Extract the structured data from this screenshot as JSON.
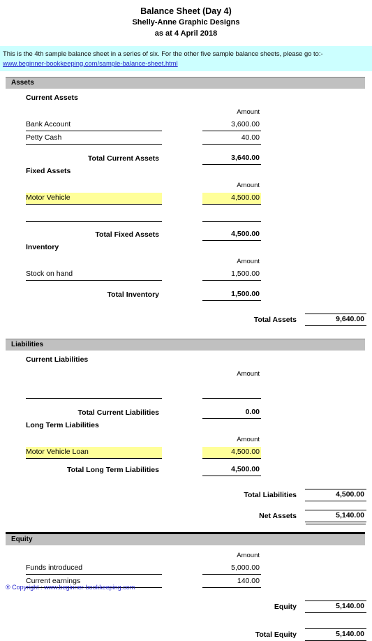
{
  "header": {
    "title": "Balance Sheet (Day 4)",
    "company": "Shelly-Anne Graphic Designs",
    "as_at": "as at 4 April 2018"
  },
  "banner": {
    "text": "This is the 4th sample balance sheet in a series of six. For the other five sample balance sheets, please go to:-",
    "link": "www.beginner-bookkeeping.com/sample-balance-sheet.html"
  },
  "amount_header": "Amount",
  "sections": {
    "assets": {
      "bar_label": "Assets",
      "current": {
        "subhead": "Current Assets",
        "rows": [
          {
            "label": "Bank Account",
            "amount": "3,600.00"
          },
          {
            "label": "Petty Cash",
            "amount": "40.00"
          }
        ],
        "total_label": "Total Current Assets",
        "total_amount": "3,640.00"
      },
      "fixed": {
        "subhead": "Fixed Assets",
        "rows": [
          {
            "label": "Motor Vehicle",
            "amount": "4,500.00"
          },
          {
            "label": "",
            "amount": ""
          }
        ],
        "total_label": "Total Fixed Assets",
        "total_amount": "4,500.00"
      },
      "inventory": {
        "subhead": "Inventory",
        "rows": [
          {
            "label": "Stock on hand",
            "amount": "1,500.00"
          }
        ],
        "total_label": "Total Inventory",
        "total_amount": "1,500.00"
      },
      "grand_label": "Total Assets",
      "grand_amount": "9,640.00"
    },
    "liabilities": {
      "bar_label": "Liabilities",
      "current": {
        "subhead": "Current Liabilities",
        "rows": [
          {
            "label": "",
            "amount": ""
          }
        ],
        "total_label": "Total Current Liabilities",
        "total_amount": "0.00"
      },
      "long_term": {
        "subhead": "Long Term Liabilities",
        "rows": [
          {
            "label": "Motor Vehicle Loan",
            "amount": "4,500.00"
          }
        ],
        "total_label": "Total Long Term Liabilities",
        "total_amount": "4,500.00"
      },
      "grand_label": "Total Liabilities",
      "grand_amount": "4,500.00",
      "net_assets_label": "Net Assets",
      "net_assets_amount": "5,140.00"
    },
    "equity": {
      "bar_label": "Equity",
      "rows": [
        {
          "label": "Funds introduced",
          "amount": "5,000.00"
        },
        {
          "label": "Current earnings",
          "amount": "140.00"
        }
      ],
      "grand_label": "Equity",
      "grand_amount": "5,140.00",
      "total_label": "Total Equity",
      "total_amount": "5,140.00"
    }
  },
  "footer": "® Copyright : www.beginner-bookkeeping.com"
}
